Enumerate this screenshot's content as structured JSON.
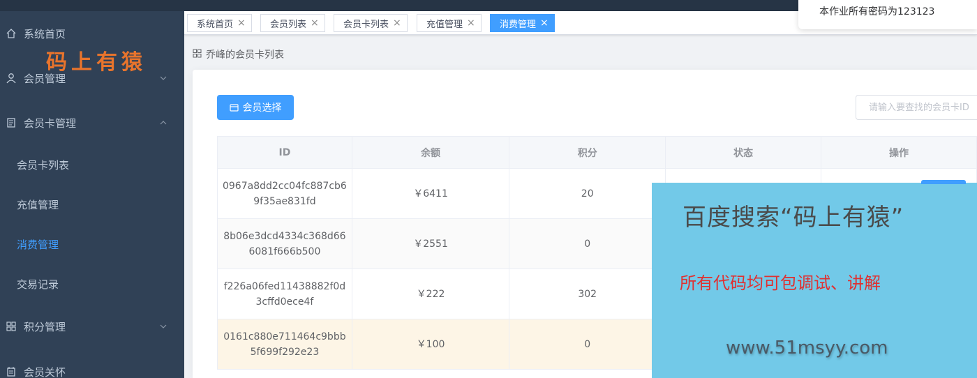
{
  "sidebar": {
    "logo_text": "码上有猿",
    "items": [
      {
        "label": "系统首页",
        "icon": "home-icon"
      },
      {
        "label": "会员管理",
        "icon": "user-icon"
      },
      {
        "label": "会员卡管理",
        "icon": "document-icon"
      },
      {
        "label": "会员卡列表"
      },
      {
        "label": "充值管理"
      },
      {
        "label": "消费管理"
      },
      {
        "label": "交易记录"
      },
      {
        "label": "积分管理",
        "icon": "grid-icon"
      },
      {
        "label": "会员关怀",
        "icon": "calendar-icon"
      }
    ]
  },
  "tags": [
    {
      "label": "系统首页"
    },
    {
      "label": "会员列表"
    },
    {
      "label": "会员卡列表"
    },
    {
      "label": "充值管理"
    },
    {
      "label": "消费管理"
    }
  ],
  "notice": "本作业所有密码为123123",
  "breadcrumb": "乔峰的会员卡列表",
  "toolbar": {
    "select_member_label": "会员选择",
    "search_placeholder": "请输入要查找的会员卡ID"
  },
  "table": {
    "headers": [
      "ID",
      "余额",
      "积分",
      "状态",
      "操作"
    ],
    "rows": [
      {
        "id": "0967a8dd2cc04fc887cb69f35ae831fd",
        "balance": "￥6411",
        "points": "20"
      },
      {
        "id": "8b06e3dcd4334c368d666081f666b500",
        "balance": "￥2551",
        "points": "0"
      },
      {
        "id": "f226a06fed11438882f0d3cffd0ece4f",
        "balance": "￥222",
        "points": "302"
      },
      {
        "id": "0161c880e711464c9bbb5f699f292e23",
        "balance": "￥100",
        "points": "0"
      }
    ]
  },
  "ad": {
    "line1": "百度搜索“码上有猿”",
    "line2": "所有代码均可包调试、讲解",
    "line3": "www.51msyy.com"
  },
  "colors": {
    "sidebar_bg": "#304156",
    "accent": "#409eff",
    "ad_bg": "#72c9e8",
    "ad_red": "#e03030",
    "logo_orange": "#e8742c"
  }
}
